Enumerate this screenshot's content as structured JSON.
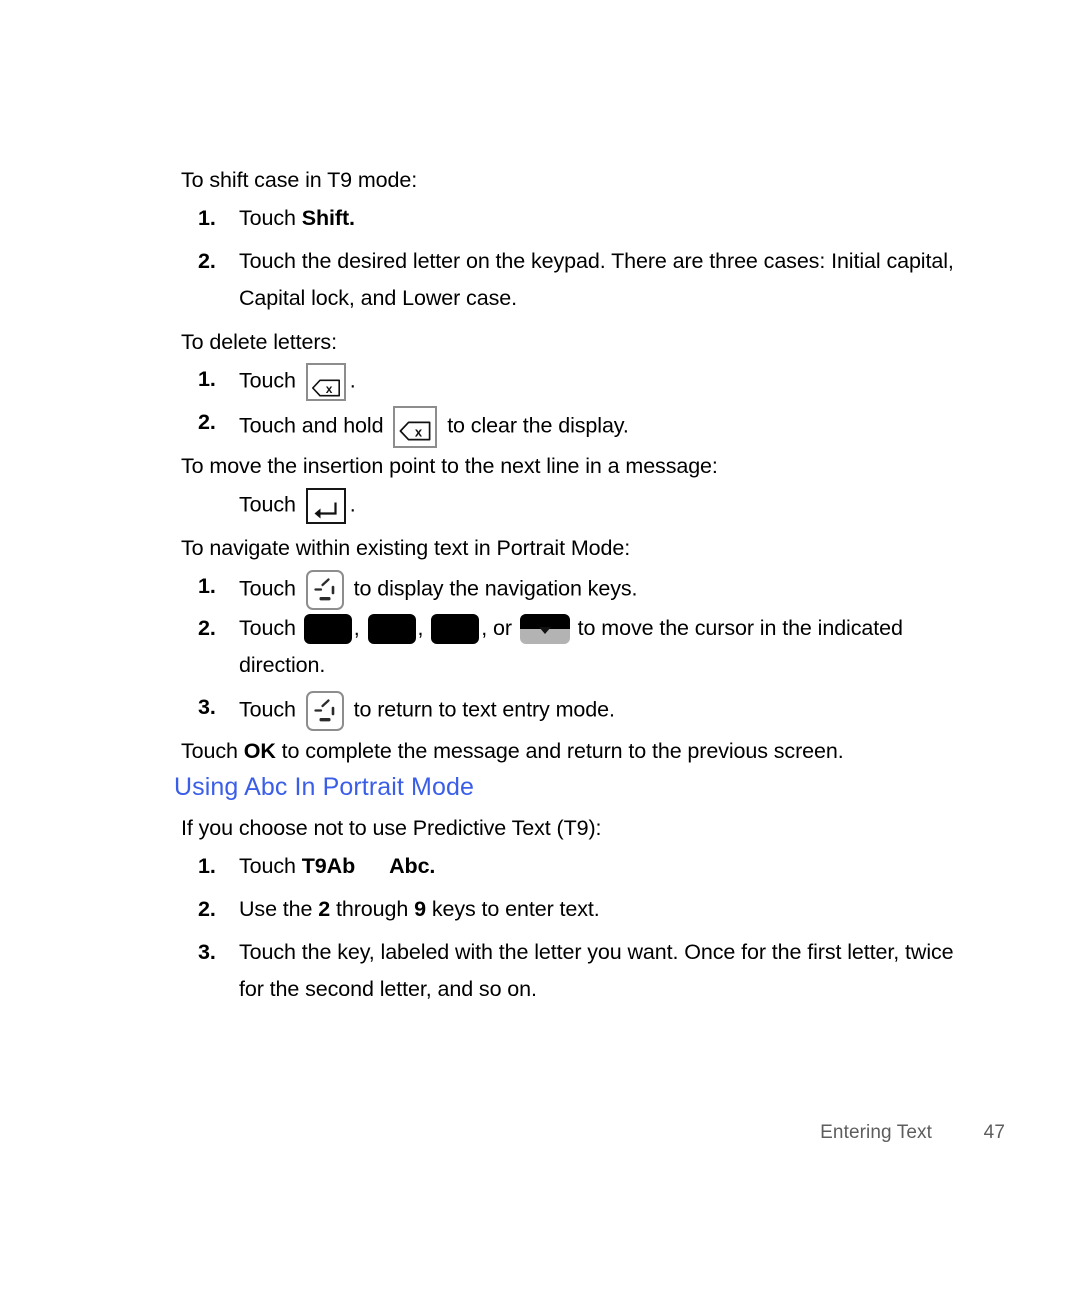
{
  "document": {
    "type": "user-manual-page",
    "page_number": "47",
    "chapter": "Entering Text",
    "heading_color": "#3b5ee8",
    "footer_color": "#5d5d5d"
  },
  "blocks": {
    "shift_intro": "To shift case in T9 mode:",
    "shift_steps": [
      {
        "num": "1.",
        "pre": "Touch ",
        "bold": "Shift.",
        "post": ""
      },
      {
        "num": "2.",
        "line1": "Touch the desired letter on the keypad. There are three cases: Initial capital,",
        "line2": "Capital lock, and Lower case."
      }
    ],
    "delete_intro": "To delete letters:",
    "delete_steps": [
      {
        "num": "1.",
        "pre": "Touch ",
        "post": "."
      },
      {
        "num": "2.",
        "pre": "Touch and hold ",
        "post": "to clear the display."
      }
    ],
    "insertion_intro": "To move the insertion point to the next line in a message:",
    "insertion_step": {
      "pre": "Touch ",
      "post": "."
    },
    "navigate_intro": "To navigate within existing text in Portrait Mode:",
    "navigate_steps": [
      {
        "num": "1.",
        "pre": "Touch ",
        "post": "to display the navigation keys."
      },
      {
        "num": "2.",
        "pre": "Touch ",
        "sep1": ",",
        "sep2": ",",
        "sep3": ", or ",
        "post": "to move the cursor in the indicated",
        "line2": "direction."
      },
      {
        "num": "3.",
        "pre": "Touch ",
        "post": "to return to text entry mode."
      }
    ],
    "ok_line": {
      "pre": "Touch ",
      "bold": "OK",
      "post": " to complete the message and return to the previous screen."
    },
    "section_heading": "Using Abc In Portrait Mode",
    "abc_intro": "If you choose not to use Predictive Text (T9):",
    "abc_steps": [
      {
        "num": "1.",
        "pre": "Touch ",
        "bold1": "T9Ab",
        "bold2": "Abc."
      },
      {
        "num": "2.",
        "pre": "Use the ",
        "bold1": "2",
        "mid": " through ",
        "bold2": "9",
        "post": " keys to enter text."
      },
      {
        "num": "3.",
        "line1": "Touch the key, labeled with the letter you want. Once for the first letter, twice",
        "line2": "for the second letter, and so on."
      }
    ]
  },
  "icons": {
    "backspace": "backspace-key-icon",
    "enter": "enter-key-icon",
    "navigation_toggle": "navigation-toggle-key-icon",
    "arrow_key": "arrow-key-icon",
    "down_arrow_key": "down-arrow-key-icon"
  }
}
